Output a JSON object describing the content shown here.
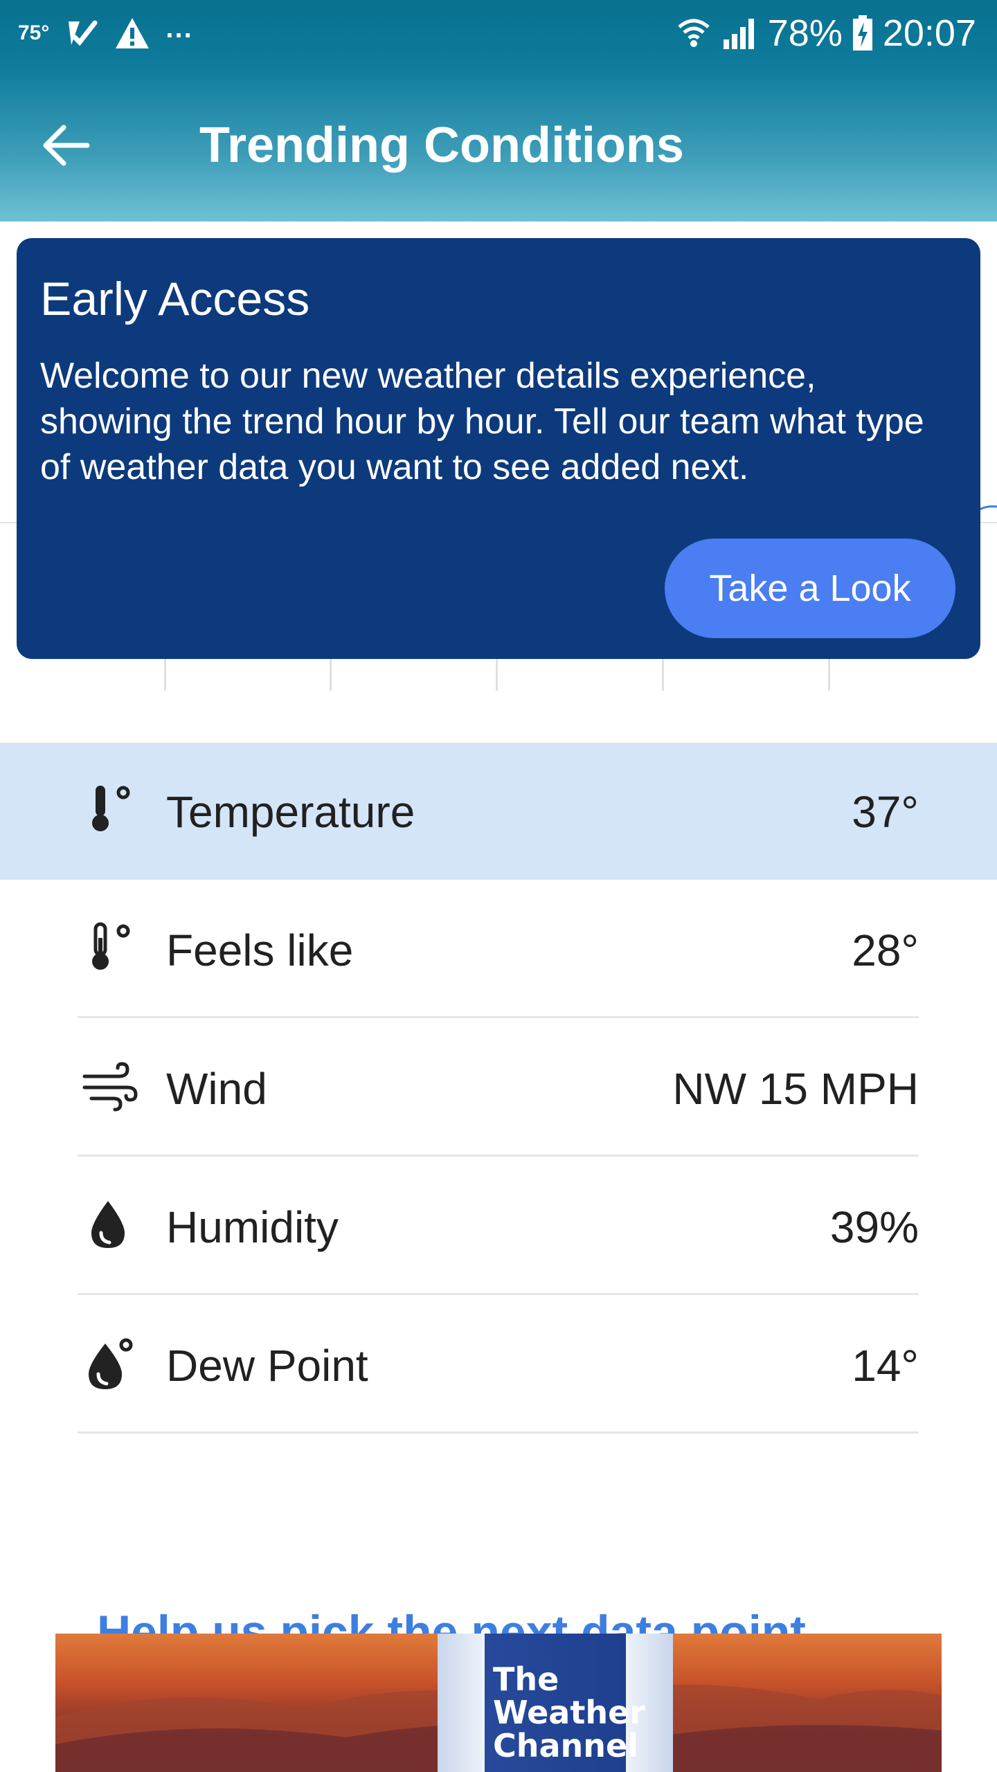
{
  "status_bar": {
    "temperature": "75°",
    "more": "...",
    "battery": "78%",
    "time": "20:07"
  },
  "app_bar": {
    "title": "Trending Conditions"
  },
  "banner": {
    "title": "Early Access",
    "body": "Welcome to our new weather details experience, showing the trend hour by hour. Tell our team what type of weather data you want to see added next.",
    "button_label": "Take a Look"
  },
  "conditions": [
    {
      "label": "Temperature",
      "value": "37°",
      "icon": "thermometer-icon",
      "active": true
    },
    {
      "label": "Feels like",
      "value": "28°",
      "icon": "thermometer-icon"
    },
    {
      "label": "Wind",
      "value": "NW 15 MPH",
      "icon": "wind-icon"
    },
    {
      "label": "Humidity",
      "value": "39%",
      "icon": "water-drop-icon"
    },
    {
      "label": "Dew Point",
      "value": "14°",
      "icon": "dew-point-icon"
    }
  ],
  "help_link": "Help us pick the next data point",
  "ad": {
    "logo_text": "The Weather Channel"
  },
  "colors": {
    "accent": "#4a7ef2",
    "card": "#0d3a7d",
    "active_row": "#d4e5f8",
    "link": "#3d7fe0"
  }
}
